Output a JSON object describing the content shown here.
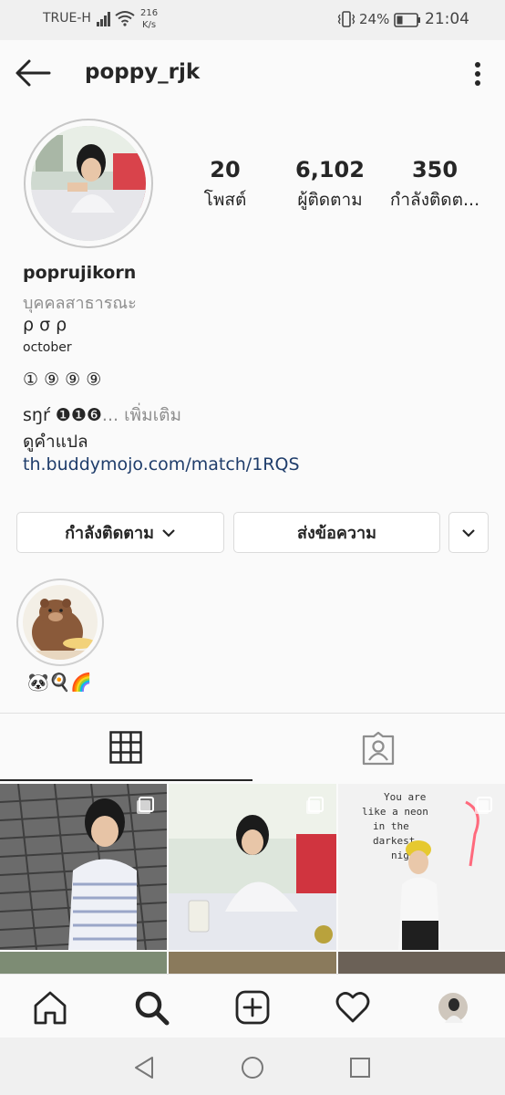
{
  "status_bar": {
    "carrier": "TRUE-H",
    "speed_value": "216",
    "speed_unit": "K/s",
    "battery": "24%",
    "time": "21:04"
  },
  "header": {
    "username": "poppy_rjk",
    "back_icon": "back-arrow-icon",
    "more_icon": "more-vertical-icon"
  },
  "profile": {
    "stats": [
      {
        "value": "20",
        "label": "โพสต์"
      },
      {
        "value": "6,102",
        "label": "ผู้ติดตาม"
      },
      {
        "value": "350",
        "label": "กำลังติดต..."
      }
    ],
    "name": "poprujikorn",
    "category": "บุคคลสาธารณะ",
    "bio_line1": "ρ σ ρ",
    "bio_line2": "october",
    "bio_line3": "① ⑨ ⑨ ⑨",
    "bio_line4": "sŋŕ ❶❶❻",
    "more_label": "... เพิ่มเติม",
    "translate": "ดูคำแปล",
    "url": "th.buddymojo.com/match/1RQS"
  },
  "actions": {
    "following": "กำลังติดตาม",
    "message": "ส่งข้อความ"
  },
  "highlights": [
    {
      "label": "🐼🍳🌈"
    }
  ],
  "tabs": [
    {
      "name": "grid-icon"
    },
    {
      "name": "tagged-icon"
    }
  ],
  "colors": {
    "background": "#fafafa",
    "link": "#1f3d6b",
    "muted": "#8e8e8e"
  },
  "bottom_nav": [
    "home-icon",
    "search-icon",
    "add-icon",
    "heart-icon",
    "profile-avatar"
  ],
  "neon_sign": "You are like a neon in the darkest night"
}
